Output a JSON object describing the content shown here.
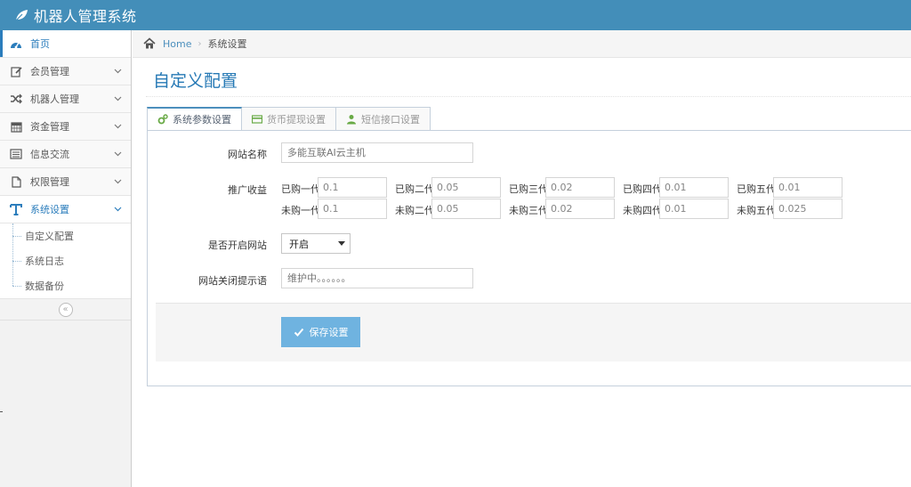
{
  "app": {
    "title": "机器人管理系统"
  },
  "sidebar": {
    "items": [
      {
        "label": "首页",
        "icon": "dashboard-icon"
      },
      {
        "label": "会员管理",
        "icon": "edit-icon"
      },
      {
        "label": "机器人管理",
        "icon": "shuffle-icon"
      },
      {
        "label": "资金管理",
        "icon": "calendar-icon"
      },
      {
        "label": "信息交流",
        "icon": "list-icon"
      },
      {
        "label": "权限管理",
        "icon": "file-icon"
      },
      {
        "label": "系统设置",
        "icon": "text-icon"
      }
    ],
    "submenu": [
      {
        "label": "自定义配置"
      },
      {
        "label": "系统日志"
      },
      {
        "label": "数据备份"
      }
    ],
    "collapse_glyph": "«"
  },
  "breadcrumb": {
    "home": "Home",
    "current": "系统设置"
  },
  "page": {
    "title": "自定义配置"
  },
  "tabs": [
    {
      "label": "系统参数设置",
      "icon": "cogs-icon"
    },
    {
      "label": "货币提现设置",
      "icon": "credit-card-icon"
    },
    {
      "label": "短信接口设置",
      "icon": "user-icon"
    }
  ],
  "form": {
    "site_name": {
      "label": "网站名称",
      "placeholder": "多能互联AI云主机"
    },
    "promotion": {
      "label": "推广收益",
      "bought": [
        {
          "label": "已购一代",
          "value": "0.1"
        },
        {
          "label": "已购二代",
          "value": "0.05"
        },
        {
          "label": "已购三代",
          "value": "0.02"
        },
        {
          "label": "已购四代",
          "value": "0.01"
        },
        {
          "label": "已购五代",
          "value": "0.01"
        }
      ],
      "unbought": [
        {
          "label": "未购一代",
          "value": "0.1"
        },
        {
          "label": "未购二代",
          "value": "0.05"
        },
        {
          "label": "未购三代",
          "value": "0.02"
        },
        {
          "label": "未购四代",
          "value": "0.01"
        },
        {
          "label": "未购五代",
          "value": "0.025"
        }
      ]
    },
    "site_open": {
      "label": "是否开启网站",
      "value": "开启"
    },
    "close_tip": {
      "label": "网站关闭提示语",
      "placeholder": "维护中。。。。。。"
    },
    "save_label": "保存设置"
  },
  "colors": {
    "topbar": "#438eb9",
    "accent": "#2b7dbc",
    "button": "#6fb3e0"
  }
}
